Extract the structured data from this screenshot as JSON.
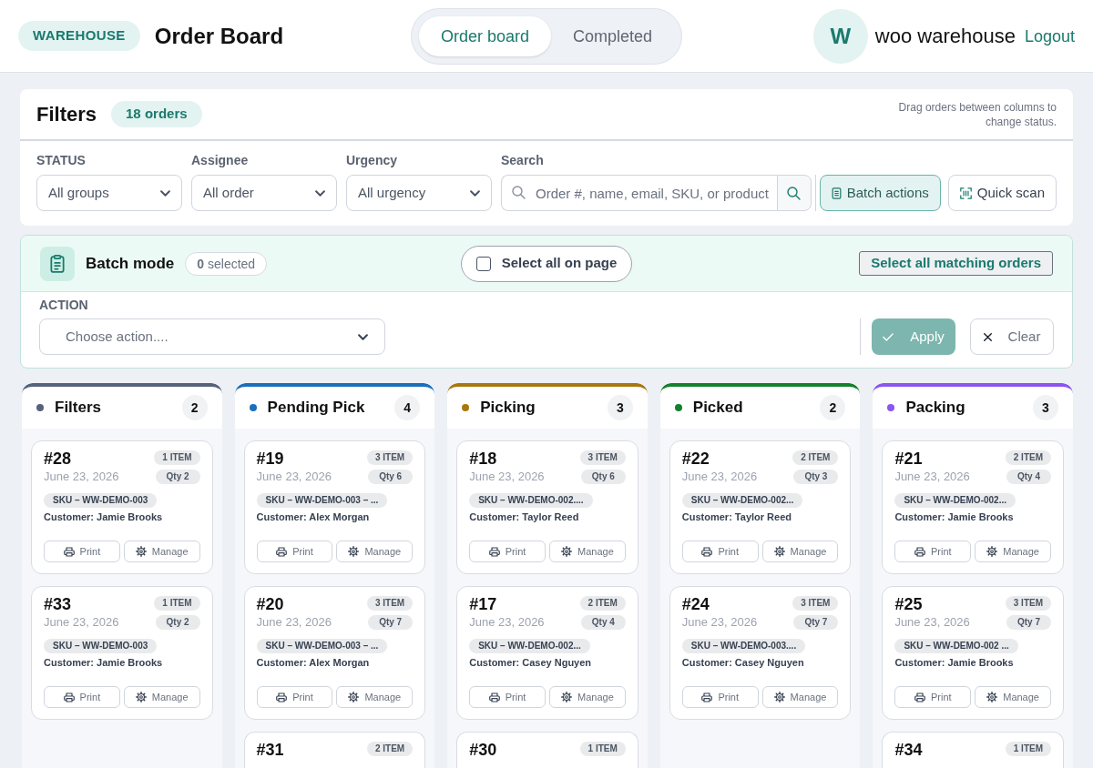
{
  "header": {
    "badge": "WAREHOUSE",
    "title": "Order Board",
    "view_tabs": [
      {
        "label": "Order board",
        "selected": true
      },
      {
        "label": "Completed",
        "selected": false
      }
    ],
    "user": {
      "initial": "W",
      "name": "woo warehouse"
    },
    "logout": "Logout"
  },
  "filters": {
    "title": "Filters",
    "count": "18 orders",
    "hint": "Drag orders between columns to change status.",
    "selects": [
      {
        "label": "STATUS",
        "value": "All groups"
      },
      {
        "label": "Assignee",
        "value": "All order"
      },
      {
        "label": "Urgency",
        "value": "All urgency"
      }
    ],
    "search": {
      "label": "Search",
      "placeholder": "Order #, name, email, SKU, or product"
    },
    "buttons": [
      {
        "kind": "batch",
        "label": "Batch actions",
        "selected": true
      },
      {
        "kind": "scan",
        "label": "Quick scan",
        "selected": false
      }
    ]
  },
  "batch": {
    "title": "Batch mode",
    "selected_count": "**0** selected",
    "select_all_page": {
      "label": "Select all on page",
      "checked": false
    },
    "select_all_matching": "Select all matching orders",
    "action": {
      "label": "ACTION",
      "placeholder": "Choose action...."
    },
    "apply": {
      "label": "Apply",
      "disabled": true
    },
    "clear": "Clear"
  },
  "columns": [
    {
      "title": "Filters",
      "count": "2",
      "color": "#56627a",
      "cards": [
        {
          "number": "#28",
          "items": "1 ITEM",
          "date": "June 23, 2026",
          "qty": "Qty 2",
          "sku": "SKU – WW-DEMO-003",
          "customer": "Customer: Jamie Brooks",
          "actions": [
            {
              "kind": "print",
              "label": "Print"
            },
            {
              "kind": "manage",
              "label": "Manage"
            }
          ]
        },
        {
          "number": "#33",
          "items": "1 ITEM",
          "date": "June 23, 2026",
          "qty": "Qty 2",
          "sku": "SKU – WW-DEMO-003",
          "customer": "Customer: Jamie Brooks",
          "actions": [
            {
              "kind": "print",
              "label": "Print"
            },
            {
              "kind": "manage",
              "label": "Manage"
            }
          ]
        }
      ]
    },
    {
      "title": "Pending Pick",
      "count": "4",
      "color": "#1a6fbd",
      "cards": [
        {
          "number": "#19",
          "items": "3 ITEM",
          "date": "June 23, 2026",
          "qty": "Qty 6",
          "sku": "SKU – WW-DEMO-003 – ...",
          "customer": "Customer: Alex Morgan",
          "actions": [
            {
              "kind": "print",
              "label": "Print"
            },
            {
              "kind": "manage",
              "label": "Manage"
            }
          ]
        },
        {
          "number": "#20",
          "items": "3 ITEM",
          "date": "June 23, 2026",
          "qty": "Qty 7",
          "sku": "SKU – WW-DEMO-003 – ...",
          "customer": "Customer: Alex Morgan",
          "actions": [
            {
              "kind": "print",
              "label": "Print"
            },
            {
              "kind": "manage",
              "label": "Manage"
            }
          ]
        },
        {
          "number": "#31",
          "items": "2 ITEM"
        }
      ]
    },
    {
      "title": "Picking",
      "count": "3",
      "color": "#a8780f",
      "cards": [
        {
          "number": "#18",
          "items": "3 ITEM",
          "date": "June 23, 2026",
          "qty": "Qty 6",
          "sku": "SKU – WW-DEMO-002....",
          "customer": "Customer: Taylor Reed",
          "actions": [
            {
              "kind": "print",
              "label": "Print"
            },
            {
              "kind": "manage",
              "label": "Manage"
            }
          ]
        },
        {
          "number": "#17",
          "items": "2 ITEM",
          "date": "June 23, 2026",
          "qty": "Qty 4",
          "sku": "SKU – WW-DEMO-002...",
          "customer": "Customer: Casey Nguyen",
          "actions": [
            {
              "kind": "print",
              "label": "Print"
            },
            {
              "kind": "manage",
              "label": "Manage"
            }
          ]
        },
        {
          "number": "#30",
          "items": "1 ITEM"
        }
      ]
    },
    {
      "title": "Picked",
      "count": "2",
      "color": "#14812c",
      "cards": [
        {
          "number": "#22",
          "items": "2 ITEM",
          "date": "June 23, 2026",
          "qty": "Qty 3",
          "sku": "SKU – WW-DEMO-002...",
          "customer": "Customer: Taylor Reed",
          "actions": [
            {
              "kind": "print",
              "label": "Print"
            },
            {
              "kind": "manage",
              "label": "Manage"
            }
          ]
        },
        {
          "number": "#24",
          "items": "3 ITEM",
          "date": "June 23, 2026",
          "qty": "Qty 7",
          "sku": "SKU – WW-DEMO-003....",
          "customer": "Customer: Casey Nguyen",
          "actions": [
            {
              "kind": "print",
              "label": "Print"
            },
            {
              "kind": "manage",
              "label": "Manage"
            }
          ]
        }
      ]
    },
    {
      "title": "Packing",
      "count": "3",
      "color": "#8b55f0",
      "cards": [
        {
          "number": "#21",
          "items": "2 ITEM",
          "date": "June 23, 2026",
          "qty": "Qty 4",
          "sku": "SKU – WW-DEMO-002...",
          "customer": "Customer: Jamie Brooks",
          "actions": [
            {
              "kind": "print",
              "label": "Print"
            },
            {
              "kind": "manage",
              "label": "Manage"
            }
          ]
        },
        {
          "number": "#25",
          "items": "3 ITEM",
          "date": "June 23, 2026",
          "qty": "Qty 7",
          "sku": "SKU – WW-DEMO-002 ...",
          "customer": "Customer: Jamie Brooks",
          "actions": [
            {
              "kind": "print",
              "label": "Print"
            },
            {
              "kind": "manage",
              "label": "Manage"
            }
          ]
        },
        {
          "number": "#34",
          "items": "1 ITEM"
        }
      ]
    }
  ]
}
